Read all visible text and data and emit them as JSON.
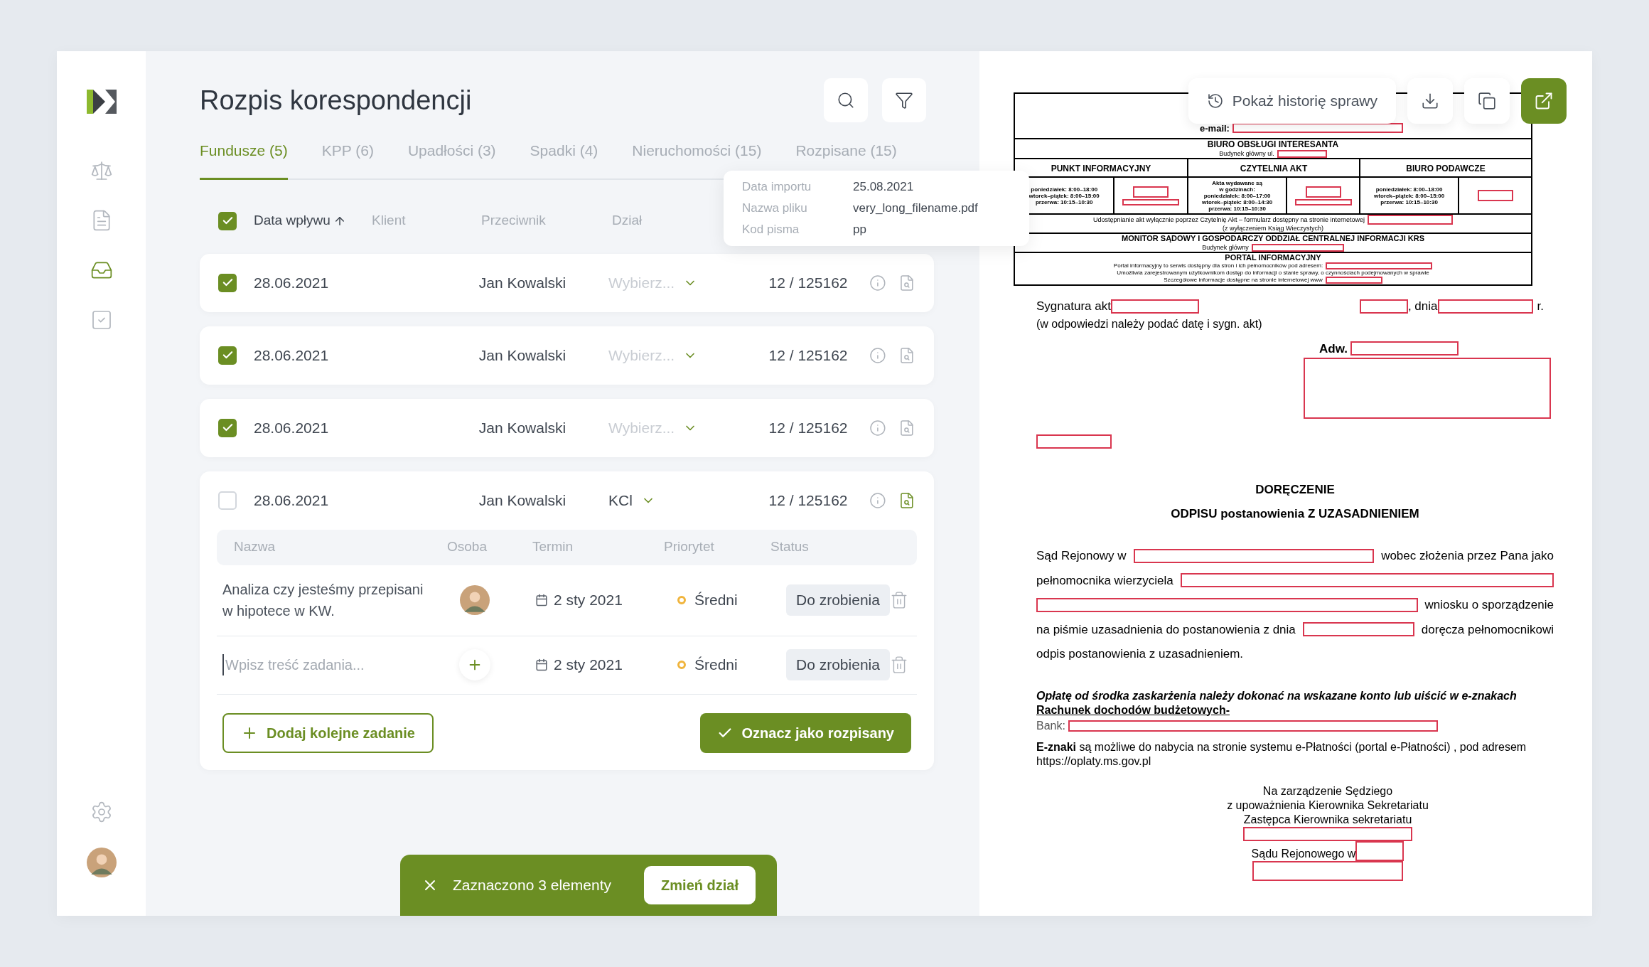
{
  "sidebar": {
    "items": [
      {
        "selected": false
      },
      {
        "selected": false
      },
      {
        "selected": true
      },
      {
        "selected": false
      }
    ]
  },
  "title": "Rozpis korespondencji",
  "tabs": [
    {
      "label": "Fundusze (5)",
      "selected": true
    },
    {
      "label": "KPP (6)",
      "selected": false
    },
    {
      "label": "Upadłości (3)",
      "selected": false
    },
    {
      "label": "Spadki (4)",
      "selected": false
    },
    {
      "label": "Nieruchomości (15)",
      "selected": false
    },
    {
      "label": "Rozpisane (15)",
      "selected": false
    }
  ],
  "table": {
    "select_all": true,
    "columns": [
      "Data wpływu",
      "Klient",
      "Przeciwnik",
      "Dział"
    ],
    "rows": [
      {
        "checked": true,
        "date": "28.06.2021",
        "opponent": "Jan Kowalski",
        "department": {
          "placeholder": "Wybierz..."
        },
        "number": "12 / 125162",
        "preview_active": false,
        "expanded": false
      },
      {
        "checked": true,
        "date": "28.06.2021",
        "opponent": "Jan Kowalski",
        "department": {
          "placeholder": "Wybierz..."
        },
        "number": "12 / 125162",
        "preview_active": false,
        "expanded": false
      },
      {
        "checked": true,
        "date": "28.06.2021",
        "opponent": "Jan Kowalski",
        "department": {
          "placeholder": "Wybierz..."
        },
        "number": "12 / 125162",
        "preview_active": false,
        "expanded": false
      },
      {
        "checked": false,
        "date": "28.06.2021",
        "opponent": "Jan Kowalski",
        "department": {
          "value": "KCl"
        },
        "number": "12 / 125162",
        "preview_active": true,
        "expanded": true
      }
    ]
  },
  "tasks": {
    "columns": [
      "Nazwa",
      "Osoba",
      "Termin",
      "Priorytet",
      "Status"
    ],
    "items": [
      {
        "name": "Analiza czy jesteśmy przepisani w hipotece w KW.",
        "date": "2 sty 2021",
        "priority": "Średni",
        "status": "Do zrobienia"
      }
    ],
    "new_task": {
      "placeholder": "Wpisz treść zadania...",
      "date": "2 sty 2021",
      "priority": "Średni",
      "status": "Do zrobienia"
    },
    "add_button": "Dodaj kolejne zadanie",
    "confirm_button": "Oznacz jako rozpisany"
  },
  "tooltip": [
    {
      "label": "Data importu",
      "value": "25.08.2021"
    },
    {
      "label": "Nazwa pliku",
      "value": "very_long_filename.pdf"
    },
    {
      "label": "Kod pisma",
      "value": "pp"
    }
  ],
  "snackbar": {
    "text": "Zaznaczono 3 elementy",
    "action": "Zmień dział"
  },
  "document_toolbar": {
    "history_button": "Pokaż historię sprawy"
  },
  "document": {
    "email_label": "e-mail:",
    "office": {
      "title": "BIURO OBSŁUGI INTERESANTA",
      "subtitle": "Budynek główny ul."
    },
    "offices": [
      {
        "title": "PUNKT INFORMACYJNY",
        "hours": [
          "poniedziałek: 8:00–18:00",
          "wtorek–piątek: 8:00–15:00",
          "przerwa: 10:15–10:30"
        ]
      },
      {
        "title": "CZYTELNIA AKT",
        "hours": [
          "Akta wydawane są",
          "w godzinach:",
          "poniedziałek: 8:00–17:00",
          "wtorek–piątek: 8:00–14:30",
          "przerwa: 10:15–10:30"
        ]
      },
      {
        "title": "BIURO PODAWCZE",
        "hours": [
          "poniedziałek: 8:00–18:00",
          "wtorek–piątek: 8:00–15:00",
          "przerwa: 10:15–10:30"
        ]
      }
    ],
    "access_note": [
      "Udostępnianie akt wyłącznie poprzez Czytelnię Akt – formularz dostępny na stronie internetowej",
      "(z wyłączeniem Ksiąg Wieczystych)"
    ],
    "monitor": {
      "title": "MONITOR SĄDOWY I GOSPODARCZY ODDZIAŁ CENTRALNEJ INFORMACJI KRS",
      "subtitle": "Budynek główny"
    },
    "portal": {
      "title": "PORTAL INFORMACYJNY",
      "lines": [
        "Portal informacyjny to serwis dostępny dla stron i ich pełnomocników pod adresem:",
        "Umożliwia zarejestrowanym użytkownikom dostęp do informacji o stanie sprawy, o czynnościach podejmowanych w sprawie",
        "Szczegółowe informacje dostępne na stronie internetowej www"
      ]
    },
    "signature_label": "Sygnatura akt",
    "date_label": ", dnia",
    "year_suffix": "r.",
    "reply_note": "(w odpowiedzi należy podać datę i sygn. akt)",
    "addressee_label": "Adw.",
    "heading": "DORĘCZENIE",
    "subheading": "ODPISU postanowienia Z UZASADNIENIEM",
    "body_lines": [
      [
        {
          "kind": "text",
          "text": "Sąd Rejonowy w"
        },
        {
          "kind": "redacted"
        },
        {
          "kind": "text",
          "text": "wobec złożenia przez Pana jako"
        }
      ],
      [
        {
          "kind": "text",
          "text": "pełnomocnika wierzyciela"
        },
        {
          "kind": "redacted"
        }
      ],
      [
        {
          "kind": "redacted"
        },
        {
          "kind": "text",
          "text": "wniosku o sporządzenie"
        }
      ],
      [
        {
          "kind": "text",
          "text": "na piśmie uzasadnienia do postanowienia z dnia"
        },
        {
          "kind": "redacted"
        },
        {
          "kind": "text",
          "text": "doręcza pełnomocnikowi"
        }
      ],
      [
        {
          "kind": "text",
          "text": "odpis postanowienia z uzasadnieniem."
        }
      ]
    ],
    "fee_note": "Opłatę od środka zaskarżenia należy dokonać na wskazane konto lub uiścić w e-znakach",
    "account_title": "Rachunek dochodów budżetowych-",
    "bank_label": "Bank:",
    "eznaki_note": "**E-znaki** są możliwe do nabycia na stronie systemu e-Płatności (portal e-Płatności) , pod adresem https://oplaty.ms.gov.pl",
    "signoff": [
      "Na zarządzenie Sędziego",
      "z upoważnienia Kierownika Sekretariatu",
      "Zastępca Kierownika sekretariatu"
    ],
    "court_label": "Sądu Rejonowego w"
  }
}
